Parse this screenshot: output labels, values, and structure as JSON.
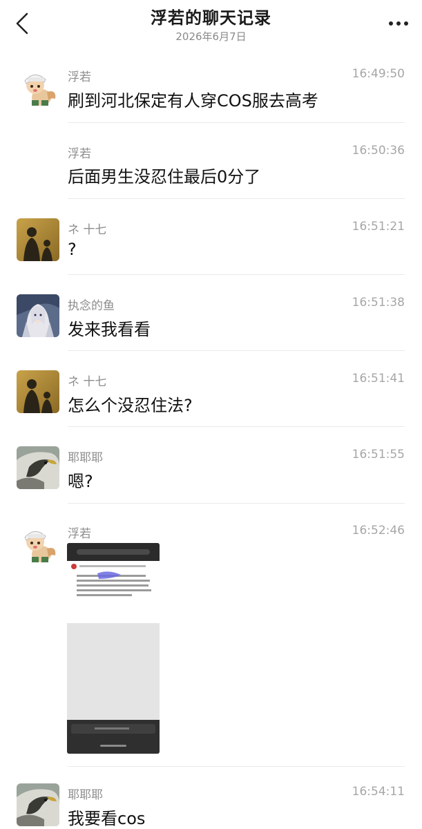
{
  "header": {
    "title": "浮若的聊天记录",
    "date": "2026年6月7日"
  },
  "messages": [
    {
      "sender": "浮若",
      "time": "16:49:50",
      "text": "刷到河北保定有人穿COS服去高考",
      "avatar": "cartoon-fox-cap-avatar"
    },
    {
      "sender": "浮若",
      "time": "16:50:36",
      "text": "后面男生没忍住最后0分了"
    },
    {
      "sender": "ネ 十七",
      "time": "16:51:21",
      "text": "?",
      "avatar": "silhouette-photo-avatar"
    },
    {
      "sender": "执念的鱼",
      "time": "16:51:38",
      "text": "发来我看看",
      "avatar": "anime-character-avatar"
    },
    {
      "sender": "ネ 十七",
      "time": "16:51:41",
      "text": "怎么个没忍住法?",
      "avatar": "silhouette-photo-avatar"
    },
    {
      "sender": "耶耶耶",
      "time": "16:51:55",
      "text": "嗯?",
      "avatar": "eagle-photo-avatar"
    },
    {
      "sender": "浮若",
      "time": "16:52:46",
      "text": "",
      "image": "phone-screenshot-thumbnail",
      "avatar": "cartoon-fox-cap-avatar"
    },
    {
      "sender": "耶耶耶",
      "time": "16:54:11",
      "text": "我要看cos",
      "avatar": "eagle-photo-avatar"
    }
  ],
  "colors": {
    "title": "#1a1a1a",
    "sender": "#8c8c8c",
    "time": "#a6a6a6",
    "text": "#111111",
    "divider": "#eaeaea"
  }
}
